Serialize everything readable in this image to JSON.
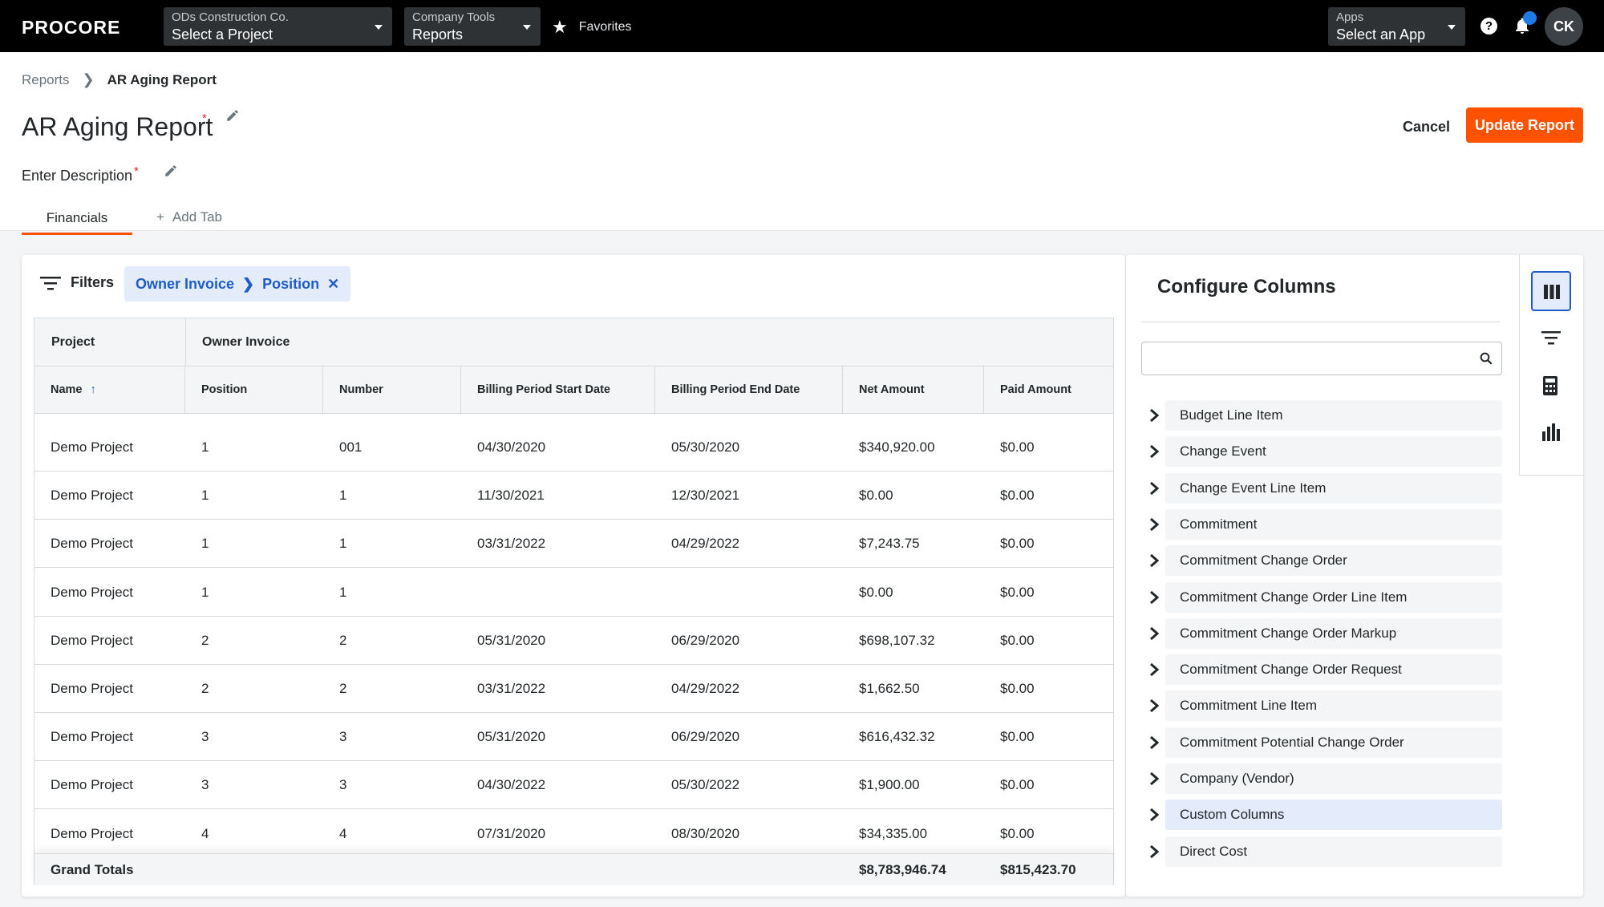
{
  "nav": {
    "logo": "PROCORE",
    "company": {
      "label": "ODs Construction Co.",
      "value": "Select a Project"
    },
    "tools": {
      "label": "Company Tools",
      "value": "Reports"
    },
    "favorites": "Favorites",
    "apps": {
      "label": "Apps",
      "value": "Select an App"
    },
    "help": "?",
    "avatar": "CK"
  },
  "breadcrumb": {
    "parent": "Reports",
    "current": "AR Aging Report"
  },
  "title": "AR Aging Report",
  "description": "Enter Description",
  "actions": {
    "cancel": "Cancel",
    "update": "Update Report"
  },
  "tabs": {
    "active": "Financials",
    "add": "Add Tab"
  },
  "filters": {
    "label": "Filters",
    "chip": {
      "part1": "Owner Invoice",
      "part2": "Position"
    }
  },
  "table": {
    "groups": {
      "project": "Project",
      "invoice": "Owner Invoice"
    },
    "columns": [
      "Name",
      "Position",
      "Number",
      "Billing Period Start Date",
      "Billing Period End Date",
      "Net Amount",
      "Paid Amount"
    ],
    "rows": [
      [
        "Demo Project",
        "1",
        "001",
        "04/30/2020",
        "05/30/2020",
        "$340,920.00",
        "$0.00"
      ],
      [
        "Demo Project",
        "1",
        "1",
        "11/30/2021",
        "12/30/2021",
        "$0.00",
        "$0.00"
      ],
      [
        "Demo Project",
        "1",
        "1",
        "03/31/2022",
        "04/29/2022",
        "$7,243.75",
        "$0.00"
      ],
      [
        "Demo Project",
        "1",
        "1",
        "",
        "",
        "$0.00",
        "$0.00"
      ],
      [
        "Demo Project",
        "2",
        "2",
        "05/31/2020",
        "06/29/2020",
        "$698,107.32",
        "$0.00"
      ],
      [
        "Demo Project",
        "2",
        "2",
        "03/31/2022",
        "04/29/2022",
        "$1,662.50",
        "$0.00"
      ],
      [
        "Demo Project",
        "3",
        "3",
        "05/31/2020",
        "06/29/2020",
        "$616,432.32",
        "$0.00"
      ],
      [
        "Demo Project",
        "3",
        "3",
        "04/30/2022",
        "05/30/2022",
        "$1,900.00",
        "$0.00"
      ],
      [
        "Demo Project",
        "4",
        "4",
        "07/31/2020",
        "08/30/2020",
        "$34,335.00",
        "$0.00"
      ]
    ],
    "totals": {
      "label": "Grand Totals",
      "net": "$8,783,946.74",
      "paid": "$815,423.70"
    }
  },
  "configure": {
    "title": "Configure Columns",
    "search_placeholder": "",
    "items": [
      "Budget Line Item",
      "Change Event",
      "Change Event Line Item",
      "Commitment",
      "Commitment Change Order",
      "Commitment Change Order Line Item",
      "Commitment Change Order Markup",
      "Commitment Change Order Request",
      "Commitment Line Item",
      "Commitment Potential Change Order",
      "Company (Vendor)",
      "Custom Columns",
      "Direct Cost"
    ],
    "active_item": "Custom Columns"
  },
  "colors": {
    "accent": "#ff5200",
    "link": "#1d5cc9",
    "chip_bg": "#e4ecfb"
  }
}
